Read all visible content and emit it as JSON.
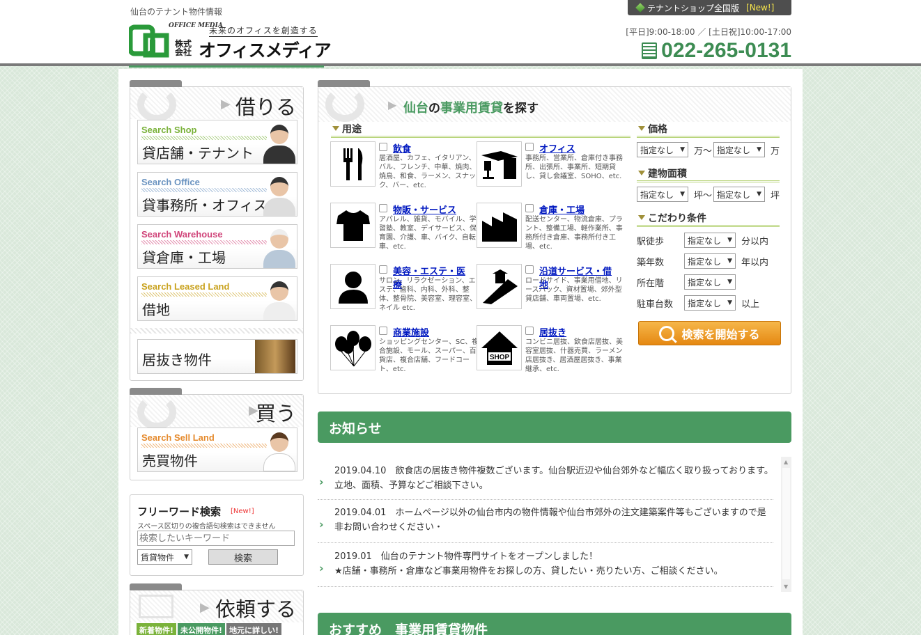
{
  "header": {
    "tagline": "仙台のテナント物件情報",
    "logo": {
      "office_media": "OFFICE MEDIA",
      "slogan": "未来のオフィスを創造する",
      "kabushiki": "株式会社",
      "name": "オフィスメディア"
    },
    "national_button": {
      "label": "テナントショップ全国版",
      "badge": "[New!]"
    },
    "hours": "[平日]9:00-18:00 ／ [土日祝]10:00-17:00",
    "phone": "022-265-0131"
  },
  "rent_box": {
    "heading": "借りる",
    "cards": [
      {
        "en": "Search Shop",
        "jp": "貸店舗・テナント",
        "color": "#7ab23a"
      },
      {
        "en": "Search Office",
        "jp": "貸事務所・オフィス",
        "color": "#6a93c0"
      },
      {
        "en": "Search Warehouse",
        "jp": "貸倉庫・工場",
        "color": "#d0457a"
      },
      {
        "en": "Search Leased Land",
        "jp": "借地",
        "color": "#c9a21e"
      }
    ],
    "inuki": "居抜き物件"
  },
  "buy_box": {
    "heading": "買う",
    "card": {
      "en": "Search Sell Land",
      "jp": "売買物件",
      "color": "#e58a2d"
    }
  },
  "freeword": {
    "title": "フリーワード検索",
    "badge": "[New!]",
    "note": "スペース区切りの複合語句検索はできません",
    "placeholder": "検索したいキーワード",
    "type_select": "賃貸物件",
    "search_label": "検索"
  },
  "request_box": {
    "heading": "依頼する",
    "tags": [
      "新着物件!",
      "未公開物件!",
      "地元に詳しい!"
    ]
  },
  "search_panel": {
    "title_parts": [
      "仙台",
      "の",
      "事業用賃貸",
      "を探す"
    ],
    "usage_heading": "用途",
    "categories": [
      {
        "label": "飲食",
        "desc": "居酒屋、カフェ、イタリアン、バル、フレンチ、中華、焼肉、焼鳥、和食、ラーメン、スナック、バー、etc."
      },
      {
        "label": "オフィス",
        "desc": "事務所、営業所、倉庫付き事務所、出張所、事業所、短期貸し、貸し会議室、SOHO、etc."
      },
      {
        "label": "物販・サービス",
        "desc": "アパレル、雑貨、モバイル、学習塾、教室、デイサービス、保育園、介護、車、バイク、自転車、etc."
      },
      {
        "label": "倉庫・工場",
        "desc": "配送センター、物流倉庫、プラント、整備工場、軽作業所、事務所付き倉庫、事務所付き工場、etc."
      },
      {
        "label": "美容・エステ・医療",
        "desc": "サロン、リラクゼーション、エステ、歯科、内科、外科、整体、整骨院、美容室、理容室、ネイル etc."
      },
      {
        "label": "沿道サービス・借地",
        "desc": "ロードサイド、事業用借地、リースバック、資材置場、郊外型貸店舗、車両置場、etc."
      },
      {
        "label": "商業施設",
        "desc": "ショッピングセンター、SC、複合施設、モール、スーパー、百貨店、複合店舗、フードコート、etc."
      },
      {
        "label": "居抜き",
        "desc": "コンビニ居抜、飲食店居抜、美容室居抜、什器売買、ラーメン店居抜き、居酒屋居抜き、事業継承、etc."
      }
    ],
    "icons": [
      "fork-knife-icon",
      "office-desk-icon",
      "tshirt-icon",
      "factory-icon",
      "person-icon",
      "road-icon",
      "balloons-icon",
      "shop-house-icon"
    ],
    "price": {
      "heading": "価格",
      "from": "指定なし",
      "unit_from": "万〜",
      "to": "指定なし",
      "unit_to": "万"
    },
    "area": {
      "heading": "建物面積",
      "from": "指定なし",
      "unit_from": "坪〜",
      "to": "指定なし",
      "unit_to": "坪"
    },
    "conditions": {
      "heading": "こだわり条件",
      "rows": [
        {
          "label": "駅徒歩",
          "value": "指定なし",
          "suffix": "分以内"
        },
        {
          "label": "築年数",
          "value": "指定なし",
          "suffix": "年以内"
        },
        {
          "label": "所在階",
          "value": "指定なし",
          "suffix": ""
        },
        {
          "label": "駐車台数",
          "value": "指定なし",
          "suffix": "以上"
        }
      ]
    },
    "start_button": "検索を開始する"
  },
  "news": {
    "heading": "お知らせ",
    "items": [
      {
        "date": "2019.04.10",
        "text": "飲食店の居抜き物件複数ございます。仙台駅近辺や仙台郊外など幅広く取り扱っております。立地、面積、予算などご相談下さい。"
      },
      {
        "date": "2019.04.01",
        "text": "ホームページ以外の仙台市内の物件情報や仙台市郊外の注文建築案件等もございますので是非お問い合わせください・"
      },
      {
        "date": "2019.01",
        "text": "仙台のテナント物件専門サイトをオープンしました！",
        "text2": "★店舗・事務所・倉庫など事業用物件をお探しの方、貸したい・売りたい方、ご相談ください。"
      }
    ]
  },
  "recommend": {
    "heading": "おすすめ　事業用賃貸物件"
  }
}
